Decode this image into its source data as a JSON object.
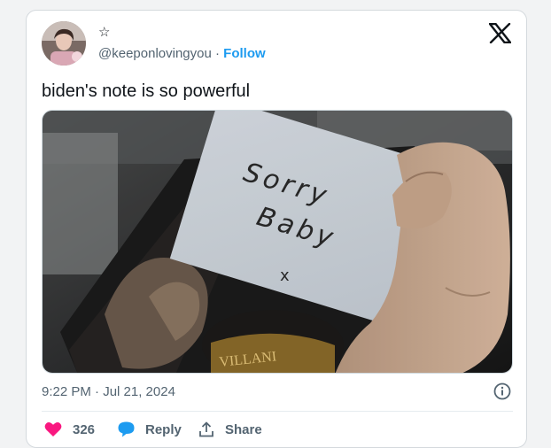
{
  "tweet": {
    "name_badge": "☆",
    "handle": "@keeponlovingyou",
    "separator": " · ",
    "follow_label": "Follow",
    "text": "biden's note is so powerful",
    "image_note_text": [
      "Sorry",
      "Baby",
      "x"
    ],
    "image_bottle_label": "VILLANI",
    "timestamp": "9:22 PM · Jul 21, 2024"
  },
  "actions": {
    "like_count": "326",
    "reply_label": "Reply",
    "share_label": "Share"
  },
  "icons": {
    "logo": "x-logo-icon",
    "info": "info-icon",
    "like": "heart-icon",
    "reply": "speech-bubble-icon",
    "share": "share-upload-icon"
  },
  "colors": {
    "accent": "#1d9bf0",
    "like": "#f91880",
    "secondary_text": "#536471"
  }
}
